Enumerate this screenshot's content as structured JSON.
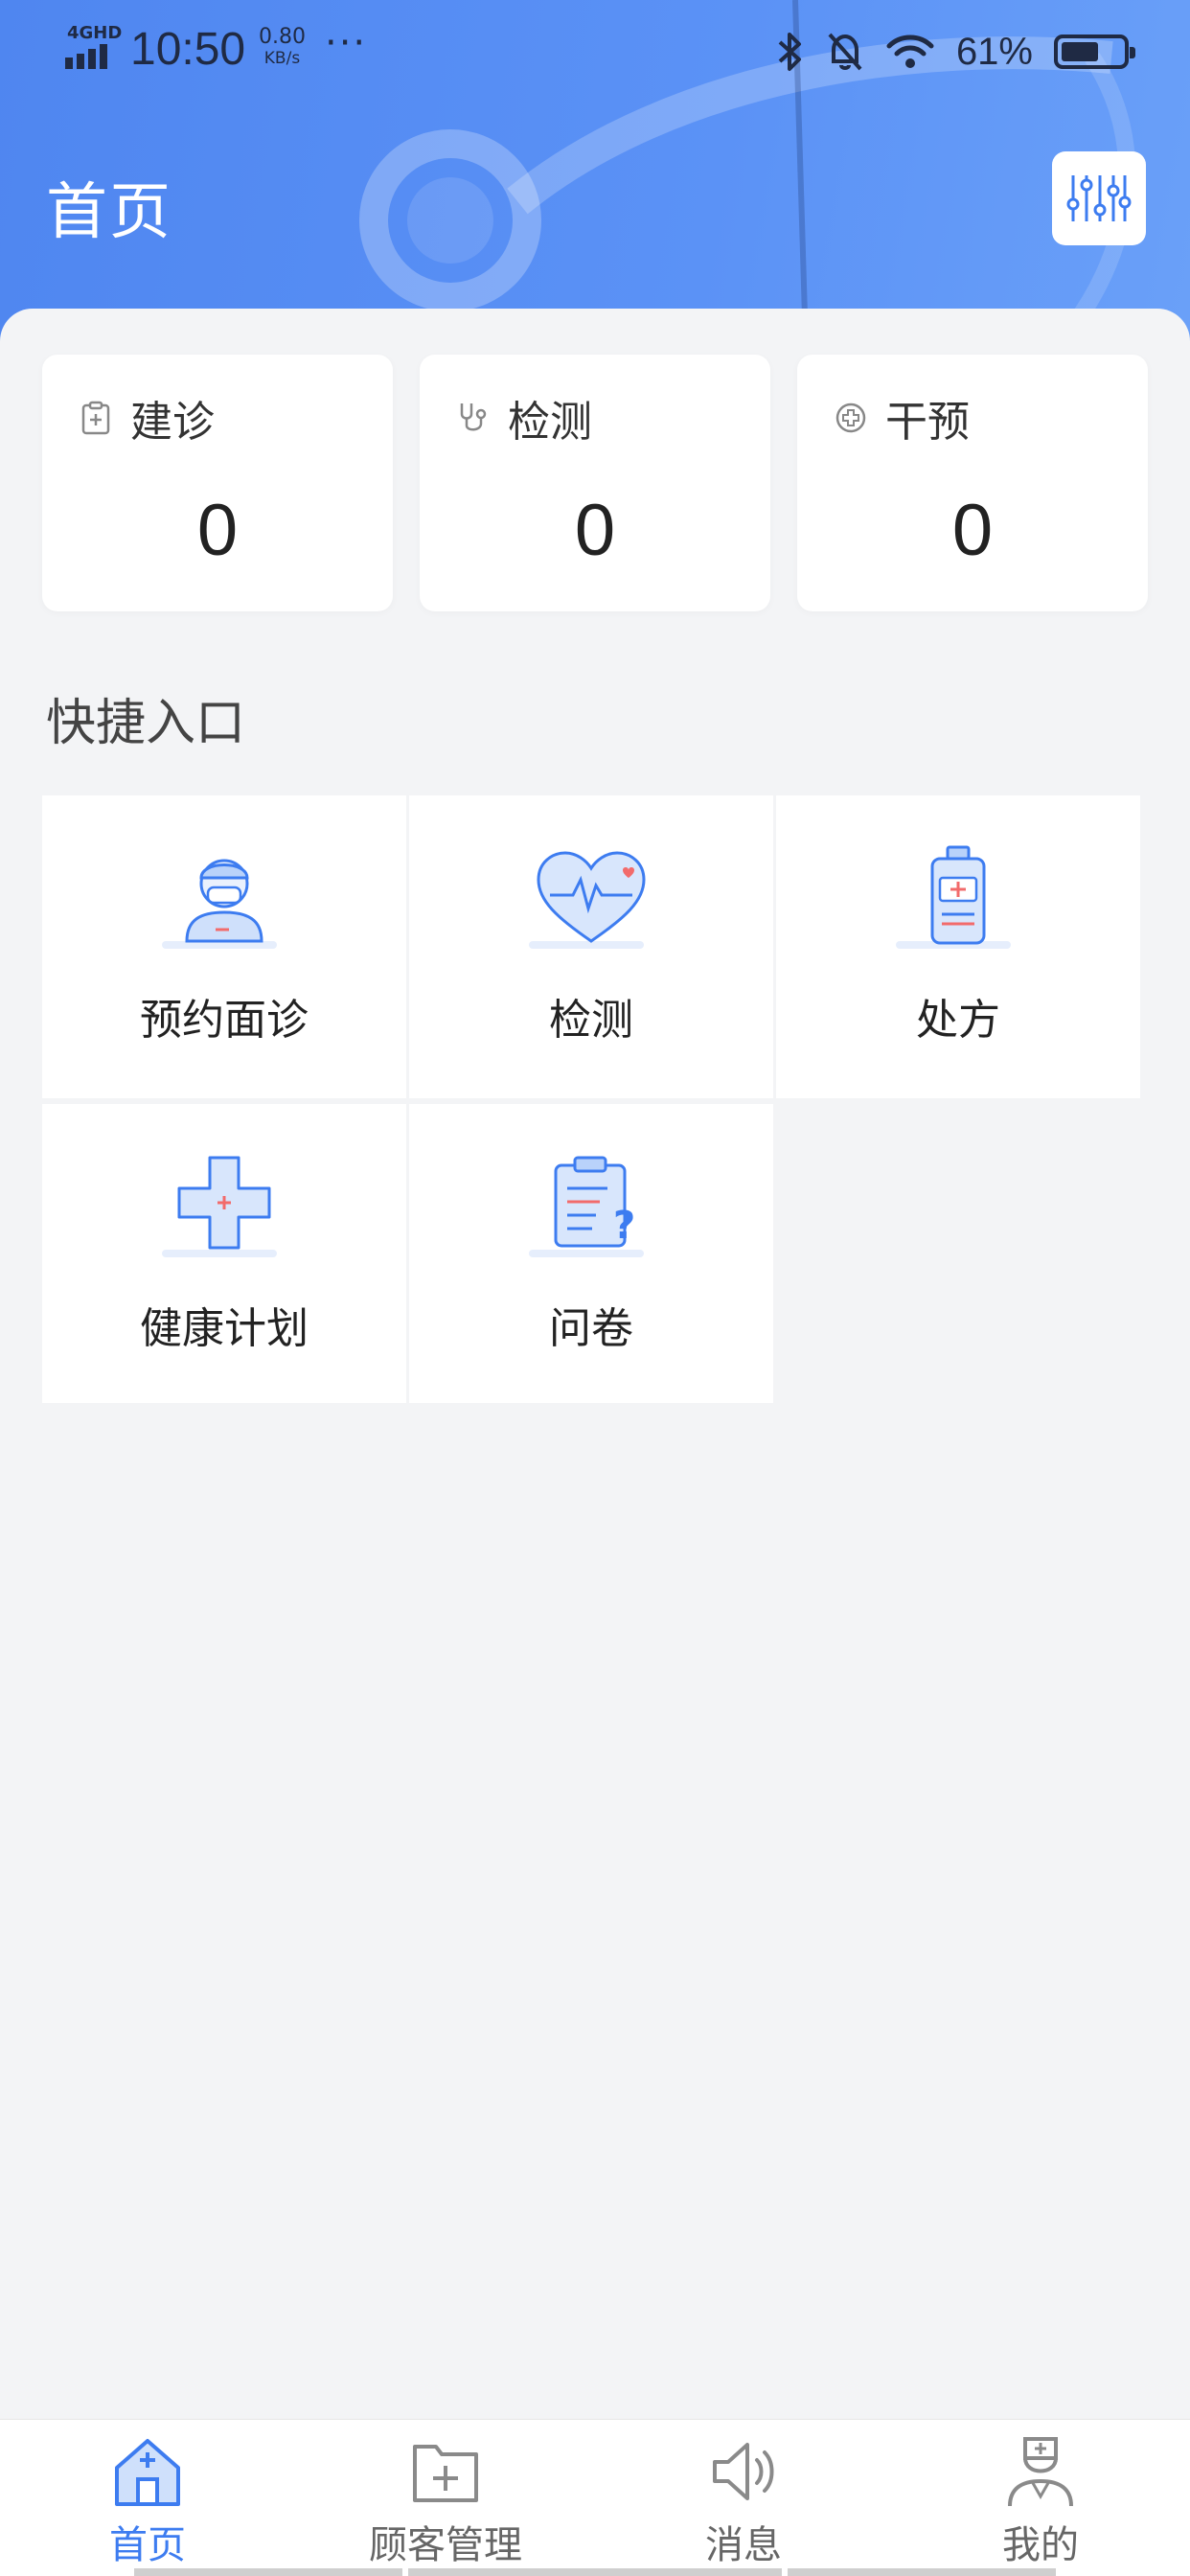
{
  "status_bar": {
    "network": "4GHD",
    "time": "10:50",
    "speed_value": "0.80",
    "speed_unit": "KB/s",
    "more": "···",
    "battery_percent": "61%",
    "battery_level": 0.61
  },
  "header": {
    "title": "首页",
    "action_icon": "data-sliders-icon",
    "accent": "#4f86f0"
  },
  "stats": [
    {
      "label": "建诊",
      "value": "0",
      "icon": "clipboard-plus-icon"
    },
    {
      "label": "检测",
      "value": "0",
      "icon": "stethoscope-icon"
    },
    {
      "label": "干预",
      "value": "0",
      "icon": "plus-circle-icon"
    }
  ],
  "quick_entry": {
    "title": "快捷入口",
    "items": [
      {
        "label": "预约面诊",
        "icon": "doctor-icon"
      },
      {
        "label": "检测",
        "icon": "heart-monitor-icon"
      },
      {
        "label": "处方",
        "icon": "medicine-bottle-icon"
      },
      {
        "label": "健康计划",
        "icon": "medical-cross-icon"
      },
      {
        "label": "问卷",
        "icon": "questionnaire-icon"
      }
    ]
  },
  "tabbar": {
    "active_color": "#3d7cf0",
    "items": [
      {
        "label": "首页",
        "icon": "hospital-home-icon",
        "active": true
      },
      {
        "label": "顾客管理",
        "icon": "folder-plus-icon",
        "active": false
      },
      {
        "label": "消息",
        "icon": "speaker-icon",
        "active": false
      },
      {
        "label": "我的",
        "icon": "doctor-profile-icon",
        "active": false
      }
    ]
  }
}
